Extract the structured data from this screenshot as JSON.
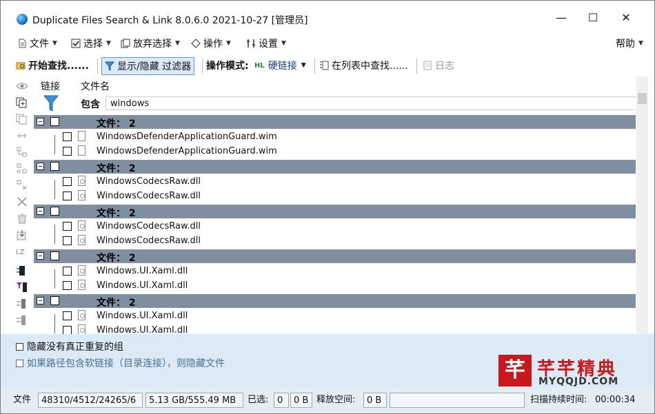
{
  "window": {
    "title": "Duplicate Files Search & Link 8.0.6.0 2021-10-27 [管理员]",
    "minimize": "—",
    "maximize": "☐",
    "close": "✕"
  },
  "menu": {
    "items": [
      "文件",
      "选择",
      "放弃选择",
      "操作",
      "设置"
    ],
    "help": "帮助"
  },
  "toolbar": {
    "start_search": "开始查找......",
    "show_hide_filter": "显示/隐藏 过滤器",
    "mode_label": "操作模式:",
    "mode_badge": "HL",
    "mode_value": "硬链接",
    "find_in_list": "在列表中查找......",
    "log": "日志"
  },
  "grid": {
    "columns": [
      "链接",
      "文件名"
    ],
    "filter_label": "包含",
    "filter_value": "windows",
    "groups": [
      {
        "label": "文件：  2",
        "files": [
          "WindowsDefenderApplicationGuard.wim",
          "WindowsDefenderApplicationGuard.wim"
        ],
        "icon": "file-icon"
      },
      {
        "label": "文件：  2",
        "files": [
          "WindowsCodecsRaw.dll",
          "WindowsCodecsRaw.dll"
        ],
        "icon": "dll-icon"
      },
      {
        "label": "文件：  2",
        "files": [
          "WindowsCodecsRaw.dll",
          "WindowsCodecsRaw.dll"
        ],
        "icon": "dll-icon"
      },
      {
        "label": "文件：  2",
        "files": [
          "Windows.UI.Xaml.dll",
          "Windows.UI.Xaml.dll"
        ],
        "icon": "dll-icon"
      },
      {
        "label": "文件：  2",
        "files": [
          "Windows.UI.Xaml.dll",
          "Windows.UI.Xaml.dll"
        ],
        "icon": "dll-icon"
      }
    ]
  },
  "options": {
    "hide_non_duplicates": "隐藏没有真正重复的组",
    "hide_symlink_paths": "如果路径包含软链接（目录连接），则隐藏文件"
  },
  "status": {
    "files_label": "文件",
    "files_value": "48310/4512/24265/6",
    "size_value": "5.13 GB/555.49 MB",
    "selected_label": "已选:",
    "selected_count": "0",
    "selected_size": "0 B",
    "free_label": "释放空间:",
    "free_value": "0 B",
    "elapsed_label": "扫描持续时间:",
    "elapsed_value": "00:00:34"
  },
  "watermark": {
    "logo_char": "芊",
    "title": "芊芊精典",
    "subtitle": "MYQQJD.COM"
  },
  "colors": {
    "group_row": "#7f8fa0",
    "bottom_panel": "#dbeaf4",
    "accent_blue": "#1a6fc9",
    "watermark_red": "#c8181e"
  }
}
